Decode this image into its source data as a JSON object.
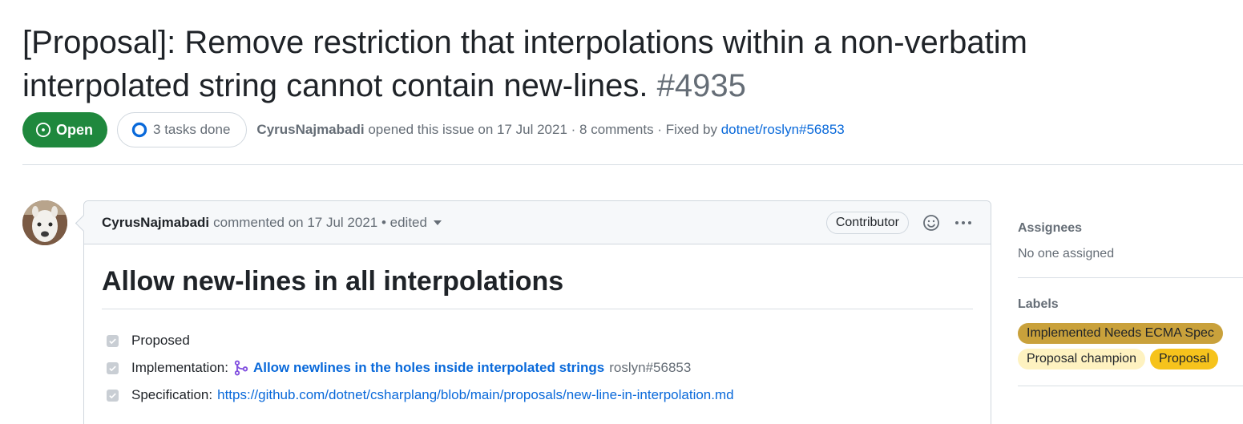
{
  "issue": {
    "title": "[Proposal]: Remove restriction that interpolations within a non-verbatim interpolated string cannot contain new-lines.",
    "number": "#4935",
    "state": "Open",
    "tasks": "3 tasks done",
    "author": "CyrusNajmabadi",
    "opened_text": "opened this issue on 17 Jul 2021 · 8 comments · Fixed by",
    "fixed_by": "dotnet/roslyn#56853"
  },
  "comment": {
    "author": "CyrusNajmabadi",
    "meta": "commented on 17 Jul 2021 • edited",
    "badge": "Contributor",
    "heading": "Allow new-lines in all interpolations",
    "tasks": [
      {
        "label": "Proposed"
      },
      {
        "label": "Implementation:",
        "link": "Allow newlines in the holes inside interpolated strings",
        "ref": "roslyn#56853"
      },
      {
        "label": "Specification:",
        "link": "https://github.com/dotnet/csharplang/blob/main/proposals/new-line-in-interpolation.md"
      }
    ]
  },
  "sidebar": {
    "assignees_heading": "Assignees",
    "assignees_value": "No one assigned",
    "labels_heading": "Labels",
    "labels": [
      {
        "name": "Implemented Needs ECMA Spec",
        "color": "#c9a13b"
      },
      {
        "name": "Proposal champion",
        "color": "#fef2c0"
      },
      {
        "name": "Proposal",
        "color": "#f6c31c"
      }
    ]
  },
  "colors": {
    "open_green": "#1f883d",
    "link_blue": "#0969da",
    "pr_purple": "#8250df"
  }
}
